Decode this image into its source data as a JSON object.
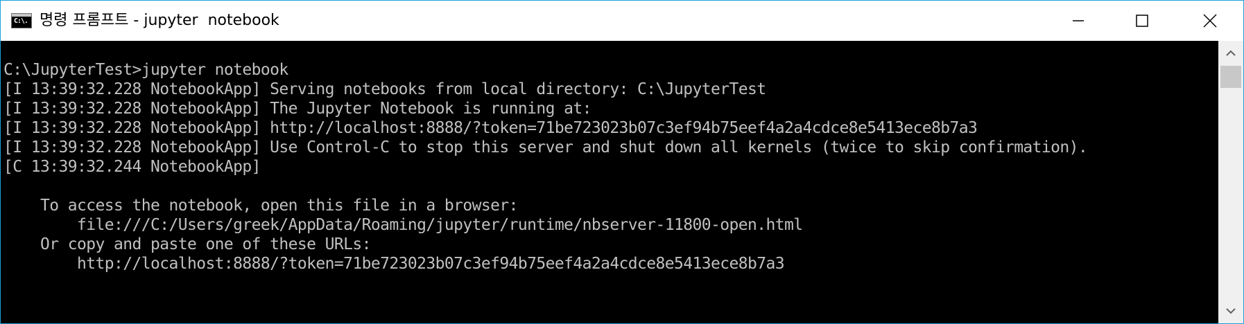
{
  "window": {
    "title": "명령 프롬프트 - jupyter  notebook",
    "app_icon_label": "C:\\.",
    "icons": {
      "app": "cmd-icon",
      "minimize": "minimize-icon",
      "maximize": "maximize-icon",
      "close": "close-icon"
    }
  },
  "console": {
    "lines": [
      "C:\\JupyterTest>jupyter notebook",
      "[I 13:39:32.228 NotebookApp] Serving notebooks from local directory: C:\\JupyterTest",
      "[I 13:39:32.228 NotebookApp] The Jupyter Notebook is running at:",
      "[I 13:39:32.228 NotebookApp] http://localhost:8888/?token=71be723023b07c3ef94b75eef4a2a4cdce8e5413ece8b7a3",
      "[I 13:39:32.228 NotebookApp] Use Control-C to stop this server and shut down all kernels (twice to skip confirmation).",
      "[C 13:39:32.244 NotebookApp]",
      "",
      "    To access the notebook, open this file in a browser:",
      "        file:///C:/Users/greek/AppData/Roaming/jupyter/runtime/nbserver-11800-open.html",
      "    Or copy and paste one of these URLs:",
      "        http://localhost:8888/?token=71be723023b07c3ef94b75eef4a2a4cdce8e5413ece8b7a3"
    ]
  },
  "scrollbar": {
    "icons": {
      "up": "scroll-up-arrow-icon",
      "down": "scroll-down-arrow-icon"
    }
  },
  "colors": {
    "console_bg": "#000000",
    "console_fg": "#c0c0c0",
    "window_border": "#1aa0d8",
    "titlebar_bg": "#ffffff"
  }
}
